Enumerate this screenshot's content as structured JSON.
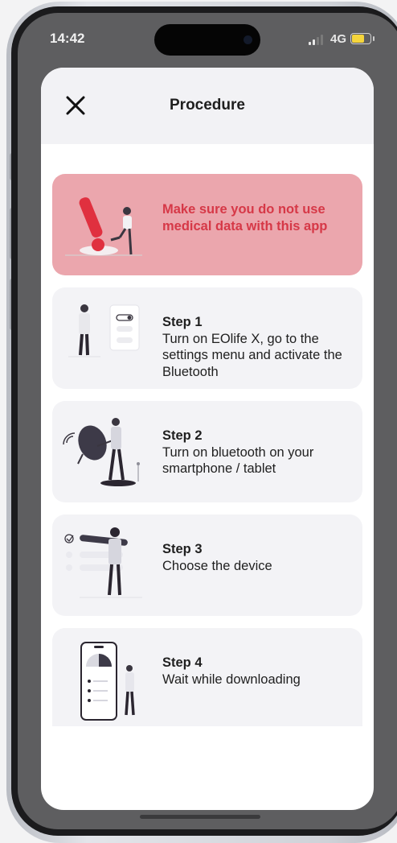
{
  "status_bar": {
    "time": "14:42",
    "network": "4G"
  },
  "header": {
    "title": "Procedure"
  },
  "warning": {
    "text": "Make sure you do not use medical data with this app"
  },
  "steps": [
    {
      "title": "Step 1",
      "desc": "Turn on EOlife X, go to the settings menu and activate the Bluetooth"
    },
    {
      "title": "Step 2",
      "desc": "Turn on bluetooth on your smartphone / tablet"
    },
    {
      "title": "Step 3",
      "desc": "Choose the device"
    },
    {
      "title": "Step 4",
      "desc": "Wait while downloading"
    }
  ],
  "colors": {
    "warning_bg": "#eba6ad",
    "warning_text": "#d63847",
    "card_bg": "#f3f3f6"
  },
  "icons": [
    "close-icon",
    "exclamation-illustration",
    "settings-toggle-illustration",
    "satellite-dish-illustration",
    "checklist-illustration",
    "phone-download-illustration"
  ]
}
